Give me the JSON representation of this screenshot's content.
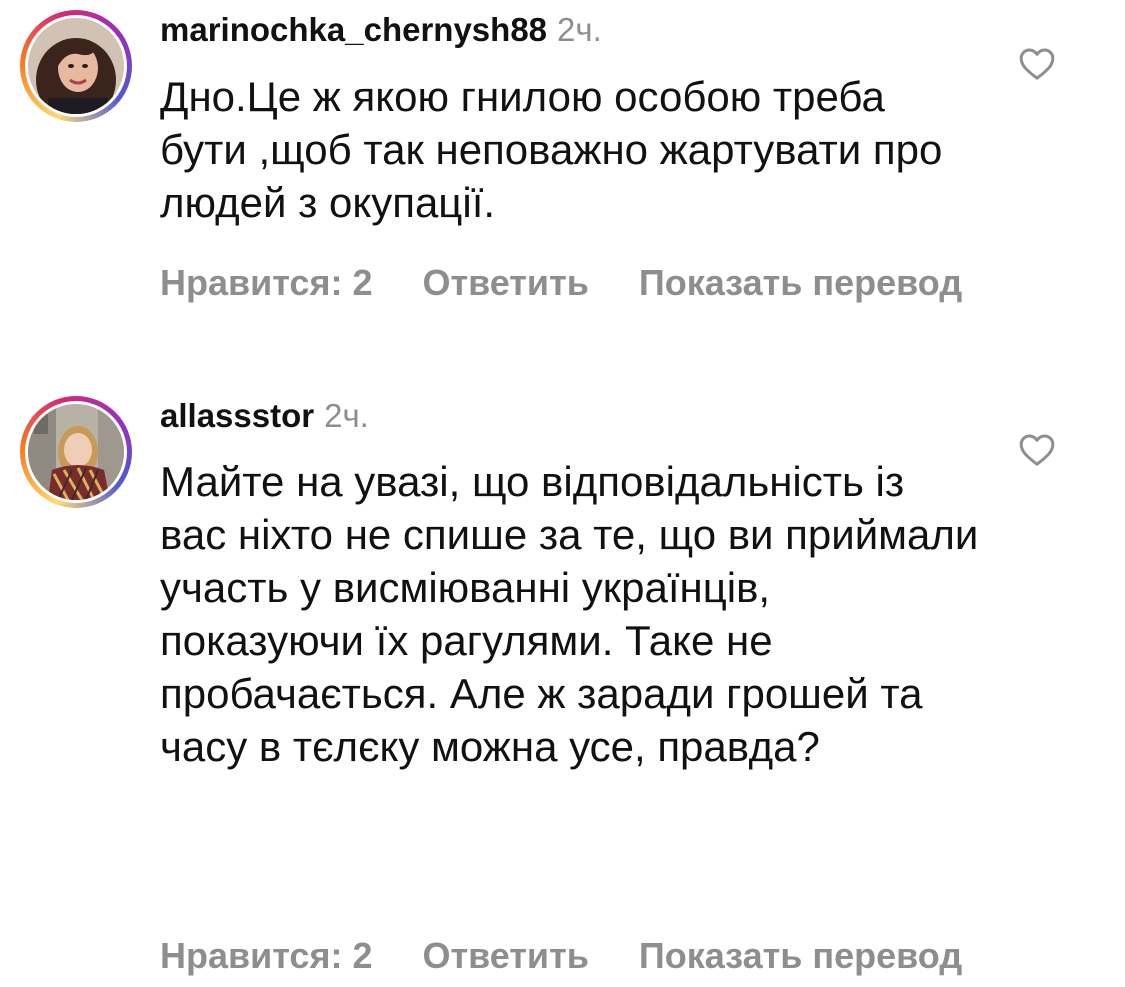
{
  "comments": [
    {
      "username": "marinochka_chernysh88",
      "time": "2ч.",
      "text": "Дно.Це ж якою гнилою особою треба бути ,щоб так неповажно жартувати про людей з окупації.",
      "likes_label": "Нравится: 2",
      "reply_label": "Ответить",
      "translate_label": "Показать перевод",
      "avatar_icon": "user-avatar-photo",
      "like_icon": "heart-outline-icon"
    },
    {
      "username": "allassstor",
      "time": "2ч.",
      "text": "Майте на увазі, що відповідальність із вас ніхто не спише за те, що ви приймали участь у висміюванні українців, показуючи їх рагулями. Таке не пробачається. Але ж заради грошей та часу в тєлєку можна усе, правда?",
      "likes_label": "Нравится: 2",
      "reply_label": "Ответить",
      "translate_label": "Показать перевод",
      "avatar_icon": "user-avatar-photo",
      "like_icon": "heart-outline-icon"
    }
  ],
  "colors": {
    "text_primary": "#111111",
    "text_secondary": "#8e8e8e",
    "story_ring": [
      "#feda75",
      "#fa7e1e",
      "#d62976",
      "#962fbf",
      "#4f5bd5"
    ]
  }
}
